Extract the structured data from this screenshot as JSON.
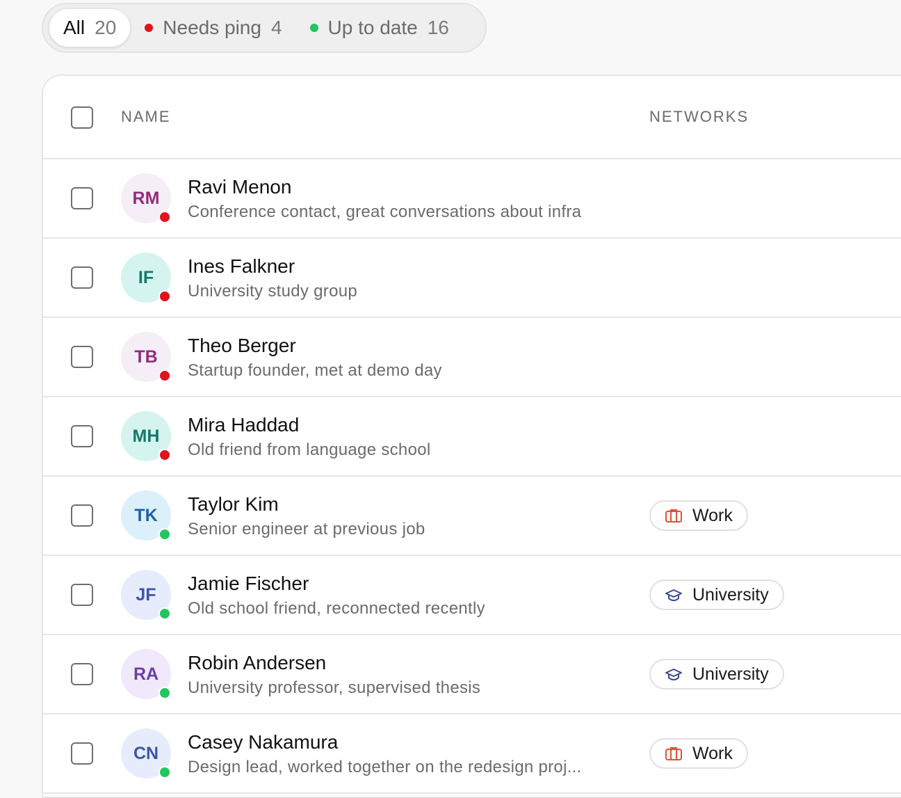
{
  "filters": {
    "all": {
      "label": "All",
      "count": "20"
    },
    "needs_ping": {
      "label": "Needs ping",
      "count": "4"
    },
    "up_to_date": {
      "label": "Up to date",
      "count": "16"
    }
  },
  "colors": {
    "needs_ping": "#e0141e",
    "up_to_date": "#22c55e",
    "work_icon": "#e0503a",
    "university_icon": "#3b4a8a"
  },
  "table": {
    "columns": {
      "name": "NAME",
      "networks": "NETWORKS"
    },
    "rows": [
      {
        "initials": "RM",
        "name": "Ravi Menon",
        "note": "Conference contact, great conversations about infra",
        "status": "needs_ping",
        "network": null,
        "avatar_bg": "#f6eef6",
        "avatar_fg": "#8e2d7c"
      },
      {
        "initials": "IF",
        "name": "Ines Falkner",
        "note": "University study group",
        "status": "needs_ping",
        "network": null,
        "avatar_bg": "#d5f4ef",
        "avatar_fg": "#14786a"
      },
      {
        "initials": "TB",
        "name": "Theo Berger",
        "note": "Startup founder, met at demo day",
        "status": "needs_ping",
        "network": null,
        "avatar_bg": "#f6eef6",
        "avatar_fg": "#8e2d7c"
      },
      {
        "initials": "MH",
        "name": "Mira Haddad",
        "note": "Old friend from language school",
        "status": "needs_ping",
        "network": null,
        "avatar_bg": "#d5f4ef",
        "avatar_fg": "#14786a"
      },
      {
        "initials": "TK",
        "name": "Taylor Kim",
        "note": "Senior engineer at previous job",
        "status": "up_to_date",
        "network": {
          "label": "Work",
          "icon": "briefcase-icon"
        },
        "avatar_bg": "#dcf0fb",
        "avatar_fg": "#1c63a0"
      },
      {
        "initials": "JF",
        "name": "Jamie Fischer",
        "note": "Old school friend, reconnected recently",
        "status": "up_to_date",
        "network": {
          "label": "University",
          "icon": "graduation-cap-icon"
        },
        "avatar_bg": "#e6ecfb",
        "avatar_fg": "#3d55a8"
      },
      {
        "initials": "RA",
        "name": "Robin Andersen",
        "note": "University professor, supervised thesis",
        "status": "up_to_date",
        "network": {
          "label": "University",
          "icon": "graduation-cap-icon"
        },
        "avatar_bg": "#efe9fb",
        "avatar_fg": "#6a3fa8"
      },
      {
        "initials": "CN",
        "name": "Casey Nakamura",
        "note": "Design lead, worked together on the redesign proj...",
        "status": "up_to_date",
        "network": {
          "label": "Work",
          "icon": "briefcase-icon"
        },
        "avatar_bg": "#e6ecfb",
        "avatar_fg": "#3d55a8"
      }
    ]
  }
}
